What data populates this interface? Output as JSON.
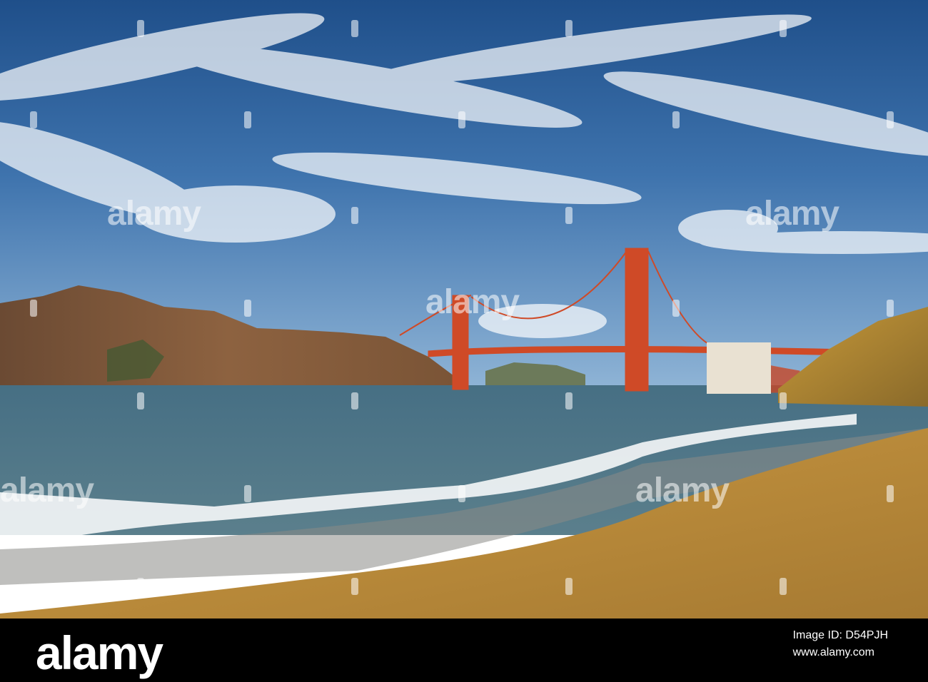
{
  "watermark": {
    "text": "alamy"
  },
  "footer": {
    "logo": "alamy",
    "image_id_label": "Image ID: D54PJH",
    "site": "www.alamy.com"
  },
  "colors": {
    "sky_top": "#2b5f9a",
    "sky_mid": "#5d8fc2",
    "bridge": "#d4492a",
    "sea": "#3d6478",
    "sand": "#b98a3a",
    "footer_bg": "#000000"
  }
}
